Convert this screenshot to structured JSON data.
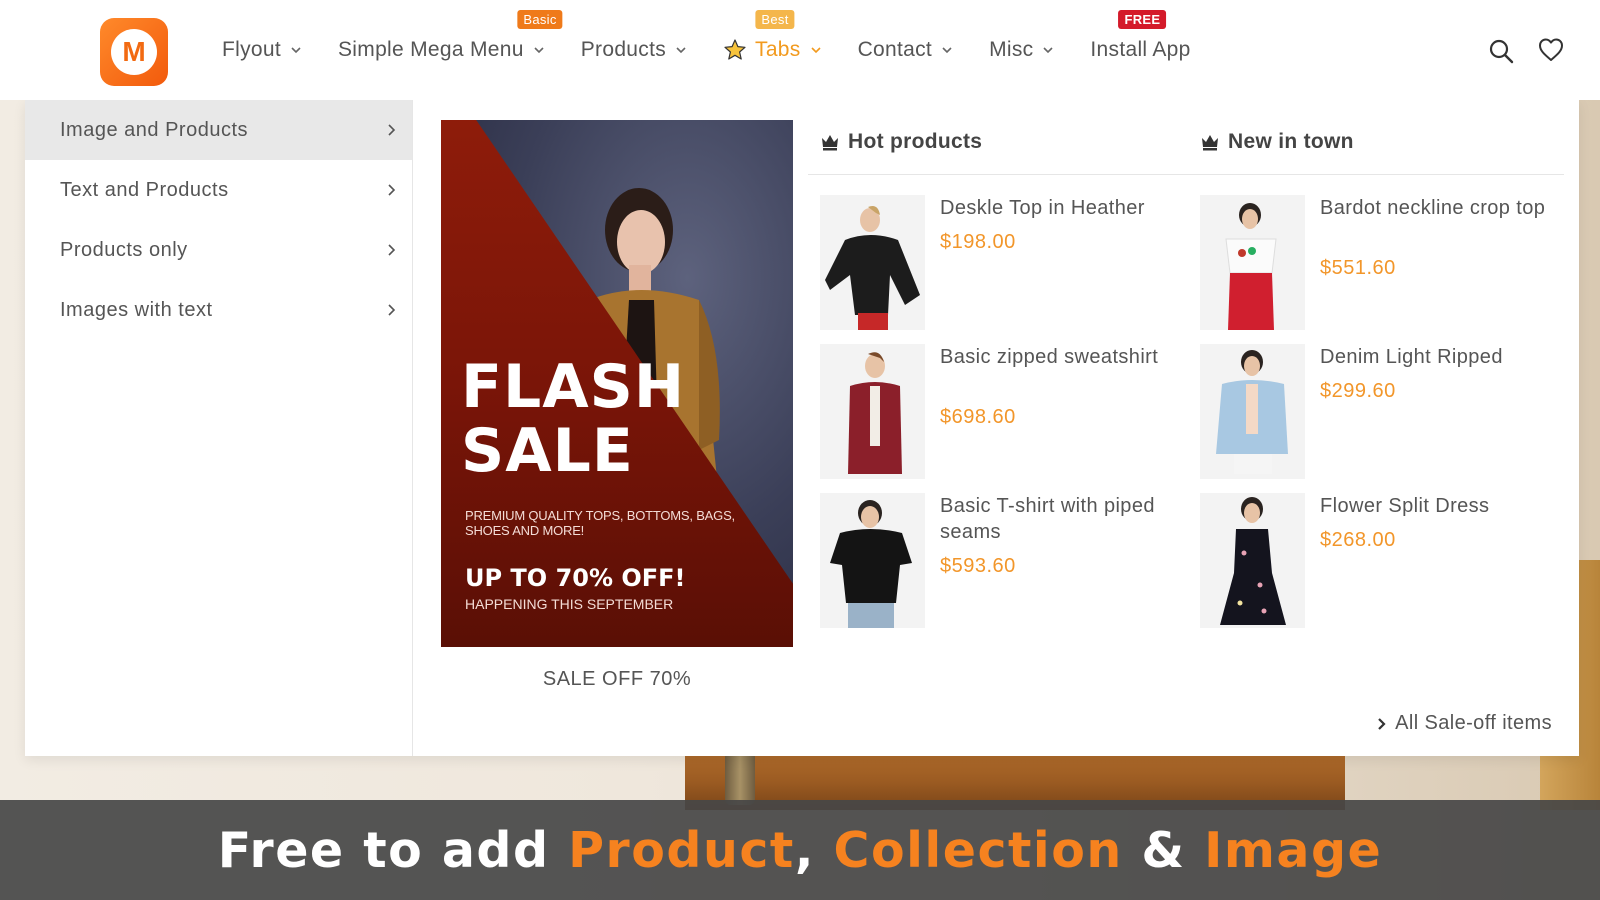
{
  "header": {
    "nav": [
      {
        "label": "Flyout",
        "badge": ""
      },
      {
        "label": "Simple Mega Menu",
        "badge": "Basic"
      },
      {
        "label": "Products",
        "badge": ""
      },
      {
        "label": "Tabs",
        "badge": "Best"
      },
      {
        "label": "Contact",
        "badge": ""
      },
      {
        "label": "Misc",
        "badge": ""
      },
      {
        "label": "Install App",
        "badge": "FREE"
      }
    ],
    "icons": [
      "search-icon",
      "heart-icon"
    ]
  },
  "mega": {
    "left_items": [
      {
        "label": "Image and Products",
        "active": true
      },
      {
        "label": "Text and Products",
        "active": false
      },
      {
        "label": "Products only",
        "active": false
      },
      {
        "label": "Images with text",
        "active": false
      }
    ],
    "banner": {
      "headline_1": "FLASH",
      "headline_2": "SALE",
      "subtext": "PREMIUM QUALITY TOPS, BOTTOMS, BAGS, SHOES AND MORE!",
      "offer": "UP TO 70% OFF!",
      "when": "HAPPENING THIS SEPTEMBER",
      "caption": "SALE OFF 70%"
    },
    "hot_products": {
      "title": "Hot products",
      "items": [
        {
          "name": "Deskle Top in Heather",
          "price": "$198.00"
        },
        {
          "name": "Basic zipped sweatshirt",
          "price": "$698.60"
        },
        {
          "name": "Basic T-shirt with piped seams",
          "price": "$593.60"
        }
      ]
    },
    "new_in_town": {
      "title": "New in town",
      "items": [
        {
          "name": "Bardot neckline crop top",
          "price": "$551.60"
        },
        {
          "name": "Denim Light Ripped",
          "price": "$299.60"
        },
        {
          "name": "Flower Split Dress",
          "price": "$268.00"
        }
      ]
    },
    "all_sale": "All Sale-off items"
  },
  "bottom": {
    "part1": "Free to add ",
    "hl1": "Product",
    "part2": ", ",
    "hl2": "Collection",
    "part3": " & ",
    "hl3": "Image"
  },
  "colors": {
    "accent": "#f6821f",
    "price": "#f2962a",
    "badge_basic": "#ef7a1a",
    "badge_best": "#f4b64b",
    "badge_free": "#d41a2a"
  }
}
